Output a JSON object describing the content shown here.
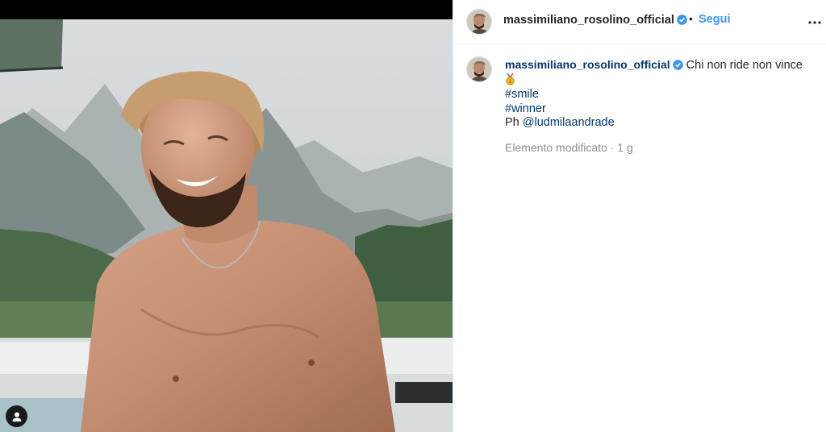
{
  "post": {
    "author": "massimiliano_rosolino_official",
    "follow_label": "Segui",
    "separator": "•"
  },
  "caption": {
    "author": "massimiliano_rosolino_official",
    "text": "Chi non ride non vince",
    "emoji": "gold-medal",
    "hashtags": [
      "#smile",
      "#winner"
    ],
    "credit_prefix": "Ph ",
    "credit_mention": "@ludmilaandrade",
    "edited_label": "Elemento modificato",
    "meta_separator": " · ",
    "age": "1 g"
  },
  "colors": {
    "link_blue": "#3897f0",
    "hashtag_blue": "#00376b",
    "verified_blue": "#3897f0",
    "meta_grey": "#8e8e8e"
  },
  "icons": [
    "user-tag-icon",
    "verified-badge-icon",
    "more-options-icon",
    "gold-medal-icon"
  ]
}
